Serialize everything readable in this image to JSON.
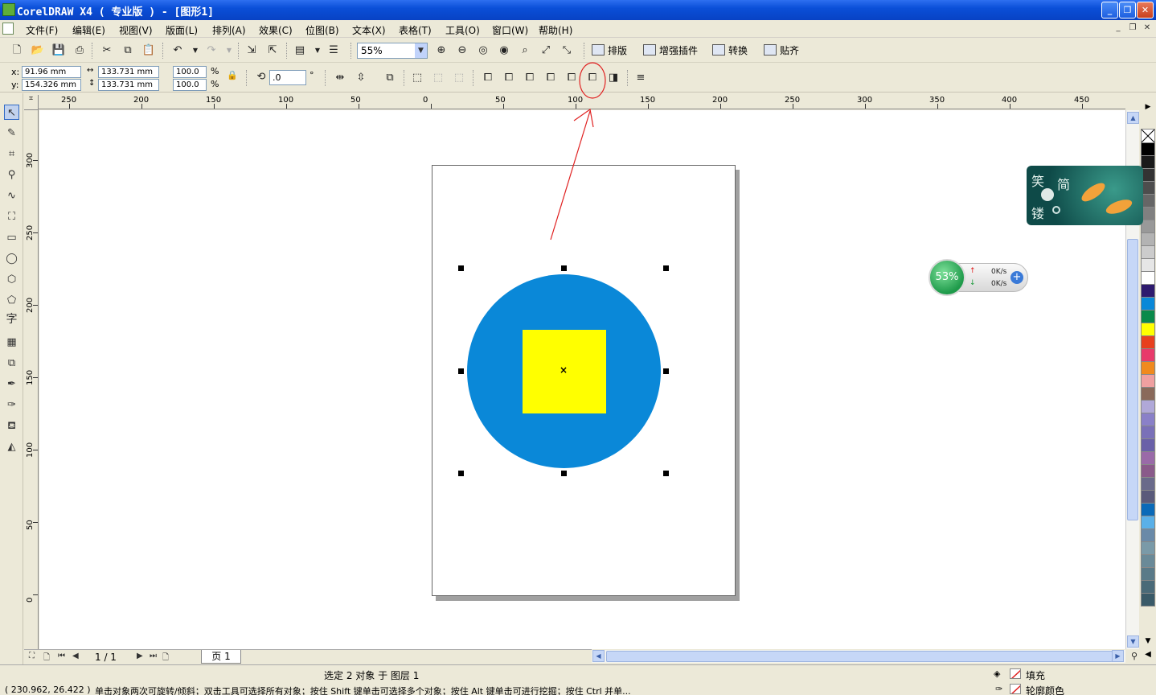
{
  "window": {
    "title": "CorelDRAW X4 ( 专业版 ) - [图形1]"
  },
  "menu": [
    "文件(F)",
    "编辑(E)",
    "视图(V)",
    "版面(L)",
    "排列(A)",
    "效果(C)",
    "位图(B)",
    "文本(X)",
    "表格(T)",
    "工具(O)",
    "窗口(W)",
    "帮助(H)"
  ],
  "toolbar": {
    "zoom": "55%",
    "custom_buttons": [
      "排版",
      "增强插件",
      "转换",
      "贴齐"
    ]
  },
  "property_bar": {
    "x_label": "x:",
    "x": "91.96 mm",
    "y_label": "y:",
    "y": "154.326 mm",
    "width": "133.731 mm",
    "height": "133.731 mm",
    "scale_w": "100.0",
    "scale_h": "100.0",
    "pct": "%",
    "rotation": ".0",
    "deg": "°"
  },
  "ruler_h": [
    "250",
    "200",
    "150",
    "100",
    "50",
    "0",
    "50",
    "100",
    "150",
    "200",
    "250",
    "300",
    "350",
    "400",
    "450"
  ],
  "ruler_v": [
    "300",
    "250",
    "200",
    "150",
    "100",
    "50",
    "0"
  ],
  "page_nav": {
    "page_count": "1 / 1",
    "tab": "页 1"
  },
  "status": {
    "selection": "选定 2 对象 于 图层 1",
    "coords": "( 230.962, 26.422 )",
    "hint": "单击对象两次可旋转/倾斜；双击工具可选择所有对象；按住 Shift 键单击可选择多个对象；按住 Alt 键单击可进行挖掘；按住 Ctrl 并单...",
    "fill_label": "填充",
    "outline_label": "轮廓颜色"
  },
  "net_meter": {
    "percent": "53%",
    "up": "0K/s",
    "down": "0K/s"
  },
  "widget": {
    "chars": [
      "笑",
      "简",
      "镂"
    ]
  },
  "shapes": {
    "circle_color": "#0a88d8",
    "square_color": "#ffff00"
  },
  "palette": [
    "#000000",
    "#1a1a1a",
    "#333333",
    "#4d4d4d",
    "#666666",
    "#808080",
    "#999999",
    "#b3b3b3",
    "#cccccc",
    "#e6e6e6",
    "#ffffff",
    "#2e1a6e",
    "#0a88d8",
    "#0a8a4a",
    "#ffff00",
    "#e8401e",
    "#e83a6a",
    "#f08a1e",
    "#f0a0a0",
    "#8a6a5a",
    "#b0a8d8",
    "#8a80c8",
    "#7a70b8",
    "#6a60a8",
    "#9a6aa8",
    "#8a5a8a",
    "#6a6a8a",
    "#5a5a7a",
    "#0a6ab8",
    "#5ab0e8",
    "#6a8aa8",
    "#7a9aa8",
    "#6a8a98",
    "#5a7a88",
    "#4a6a78",
    "#3a5a68"
  ]
}
